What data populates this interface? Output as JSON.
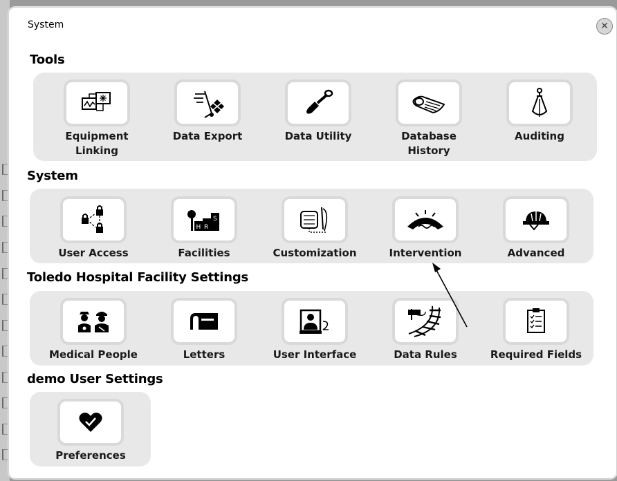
{
  "dialog": {
    "title": "System",
    "close_icon": "close-x-icon"
  },
  "sections": {
    "tools": {
      "heading": "Tools",
      "items": [
        {
          "label": "Equipment\nLinking",
          "icon": "equipment-linking-icon"
        },
        {
          "label": "Data Export",
          "icon": "data-export-icon"
        },
        {
          "label": "Data Utility",
          "icon": "shovel-icon"
        },
        {
          "label": "Database\nHistory",
          "icon": "scroll-icon"
        },
        {
          "label": "Auditing",
          "icon": "plumb-bob-icon"
        }
      ]
    },
    "system": {
      "heading": "System",
      "items": [
        {
          "label": "User Access",
          "icon": "network-locks-icon"
        },
        {
          "label": "Facilities",
          "icon": "buildings-icon"
        },
        {
          "label": "Customization",
          "icon": "tape-measure-needle-icon"
        },
        {
          "label": "Intervention",
          "icon": "bridge-icon"
        },
        {
          "label": "Advanced",
          "icon": "hard-hat-icon"
        }
      ]
    },
    "facility": {
      "heading": "Toledo Hospital Facility Settings",
      "items": [
        {
          "label": "Medical People",
          "icon": "medical-people-icon"
        },
        {
          "label": "Letters",
          "icon": "mailbox-icon"
        },
        {
          "label": "User Interface",
          "icon": "person-screen-icon"
        },
        {
          "label": "Data Rules",
          "icon": "railroad-icon"
        },
        {
          "label": "Required Fields",
          "icon": "checklist-clipboard-icon"
        }
      ]
    },
    "user": {
      "heading": "demo User Settings",
      "items": [
        {
          "label": "Preferences",
          "icon": "heart-check-icon"
        }
      ]
    }
  },
  "colors": {
    "panel": "#e8e8e8",
    "tile_border": "#d9d9d9",
    "backdrop": "#9a9a9a"
  }
}
